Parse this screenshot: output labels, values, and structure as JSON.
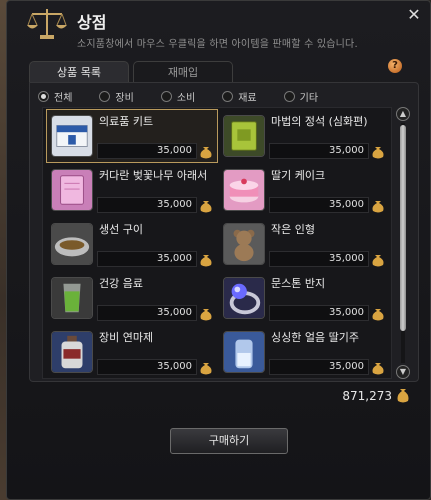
{
  "window": {
    "title": "상점",
    "subtitle": "소지품창에서 마우스 우클릭을 하면 아이템을 판매할 수 있습니다.",
    "close": "✕"
  },
  "tabs": [
    {
      "label": "상품 목록"
    },
    {
      "label": "재매입"
    }
  ],
  "help": "?",
  "filters": [
    {
      "label": "전체",
      "selected": true
    },
    {
      "label": "장비",
      "selected": false
    },
    {
      "label": "소비",
      "selected": false
    },
    {
      "label": "재료",
      "selected": false
    },
    {
      "label": "기타",
      "selected": false
    }
  ],
  "items": [
    {
      "name": "의료품 키트",
      "price": "35,000",
      "icon": "medical-box-icon"
    },
    {
      "name": "마법의 정석 (심화편)",
      "price": "35,000",
      "icon": "magic-book-icon"
    },
    {
      "name": "커다란 벚꽃나무 아래서",
      "price": "35,000",
      "icon": "pink-book-icon"
    },
    {
      "name": "딸기 케이크",
      "price": "35,000",
      "icon": "strawberry-cake-icon"
    },
    {
      "name": "생선 구이",
      "price": "35,000",
      "icon": "grilled-fish-icon"
    },
    {
      "name": "작은 인형",
      "price": "35,000",
      "icon": "teddy-bear-icon"
    },
    {
      "name": "건강 음료",
      "price": "35,000",
      "icon": "health-drink-icon"
    },
    {
      "name": "문스톤 반지",
      "price": "35,000",
      "icon": "moonstone-ring-icon"
    },
    {
      "name": "장비 연마제",
      "price": "35,000",
      "icon": "polish-bottle-icon"
    },
    {
      "name": "싱싱한 얼음 딸기주",
      "price": "35,000",
      "icon": "ice-strawberry-wine-icon"
    }
  ],
  "total": "871,273",
  "buy_button": "구매하기"
}
